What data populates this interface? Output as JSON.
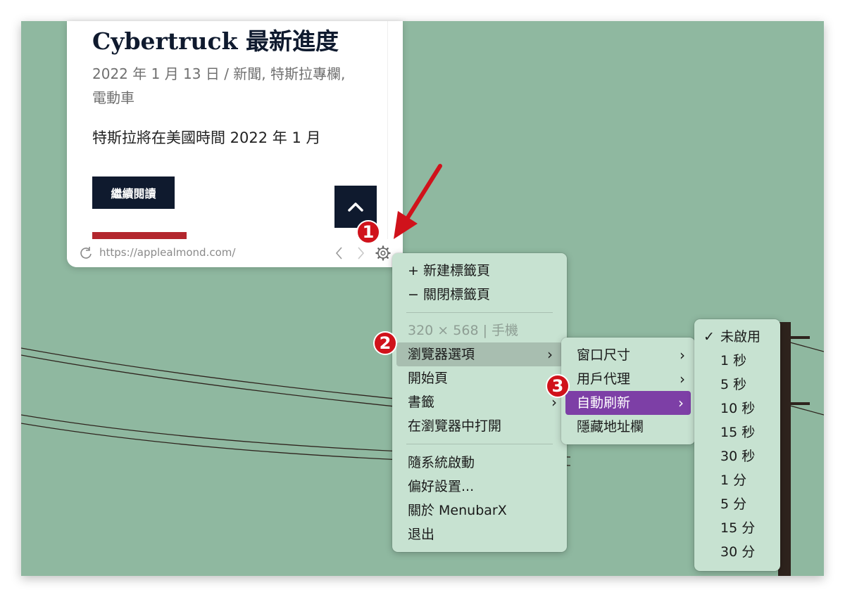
{
  "article": {
    "title": "Cybertruck 最新進度",
    "meta": "2022 年 1 月 13 日 / 新聞, 特斯拉專欄, 電動車",
    "excerpt": "特斯拉將在美國時間 2022 年 1 月",
    "read_more": "繼續閱讀"
  },
  "addressbar": {
    "url": "https://applealmond.com/"
  },
  "main_menu": {
    "new_tab": "+ 新建標籤頁",
    "close_tab": "− 關閉標籤頁",
    "size_info": "320 × 568 | 手機",
    "browser_options": "瀏覽器選項",
    "start_page": "開始頁",
    "bookmarks": "書籤",
    "open_in_browser": "在瀏覽器中打開",
    "launch_at_login": "隨系統啟動",
    "preferences": "偏好設置...",
    "about": "關於 MenubarX",
    "quit": "退出"
  },
  "browser_submenu": {
    "window_size": "窗口尺寸",
    "user_agent": "用戶代理",
    "auto_refresh": "自動刷新",
    "hide_address_bar": "隱藏地址欄"
  },
  "refresh_submenu": {
    "selected": "未啟用",
    "items": [
      "未啟用",
      "1 秒",
      "5 秒",
      "10 秒",
      "15 秒",
      "30 秒",
      "1 分",
      "5 分",
      "15 分",
      "30 分"
    ]
  },
  "annotations": {
    "step1": "1",
    "step2": "2",
    "step3": "3"
  },
  "icons": {
    "chevron": "›",
    "check": "✓"
  },
  "colors": {
    "desktop": "#8fb8a0",
    "menu_bg": "#c7e2d1",
    "highlight_purple": "#7d3fa6",
    "badge_red": "#d0121b",
    "navy": "#0f1a2e"
  }
}
